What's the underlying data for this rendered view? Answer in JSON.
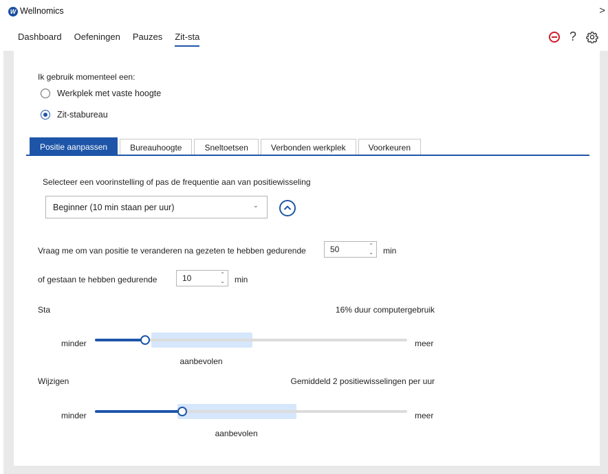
{
  "app": {
    "title": "Wellnomics",
    "logo_letter": "W",
    "collapse_glyph": ">"
  },
  "nav": {
    "tabs": [
      "Dashboard",
      "Oefeningen",
      "Pauzes",
      "Zit-sta"
    ],
    "active": 3
  },
  "top_icons": {
    "help": "?",
    "names": [
      "stop-icon",
      "help-icon",
      "gear-icon"
    ]
  },
  "colors": {
    "accent": "#1e55a8",
    "stop": "#d11a2a",
    "recommended": "#d6e6fb"
  },
  "workstation": {
    "question": "Ik gebruik momenteel een:",
    "options": [
      {
        "label": "Werkplek met vaste hoogte",
        "checked": false
      },
      {
        "label": "Zit-stabureau",
        "checked": true
      }
    ]
  },
  "subtabs": {
    "items": [
      "Positie aanpassen",
      "Bureauhoogte",
      "Sneltoetsen",
      "Verbonden werkplek",
      "Voorkeuren"
    ],
    "active": 0
  },
  "position": {
    "instruction": "Selecteer een voorinstelling of pas de frequentie aan van positiewisseling",
    "preset_value": "Beginner (10 min staan per uur)",
    "sit_prompt": "Vraag me om van positie te veranderen na gezeten te hebben gedurende",
    "sit_minutes": "50",
    "stand_prompt": "of gestaan te hebben gedurende",
    "stand_minutes": "10",
    "unit": "min"
  },
  "sliders": {
    "stand": {
      "title": "Sta",
      "summary": "16% duur computergebruik",
      "min_label": "minder",
      "max_label": "meer",
      "recommended_label": "aanbevolen",
      "value_fraction": 0.16,
      "recommended_range": [
        0.18,
        0.505
      ]
    },
    "change": {
      "title": "Wijzigen",
      "summary": "Gemiddeld 2 positiewisselingen per uur",
      "min_label": "minder",
      "max_label": "meer",
      "recommended_label": "aanbevolen",
      "value_fraction": 0.28,
      "recommended_range": [
        0.265,
        0.645
      ]
    }
  }
}
